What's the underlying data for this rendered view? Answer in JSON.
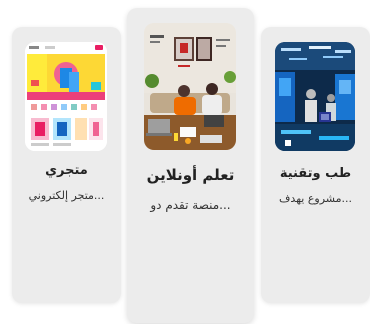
{
  "cards": [
    {
      "title": "متجري",
      "description": "...متجر إلكتروني",
      "thumbnail_icon": "ecommerce-website-screenshot"
    },
    {
      "title": "تعلم أونلاين",
      "description": "...منصة تقدم دو",
      "thumbnail_icon": "students-studying-photo"
    },
    {
      "title": "طب وتقنية",
      "description": "...مشروع يهدف",
      "thumbnail_icon": "medical-tech-lab-photo"
    }
  ]
}
